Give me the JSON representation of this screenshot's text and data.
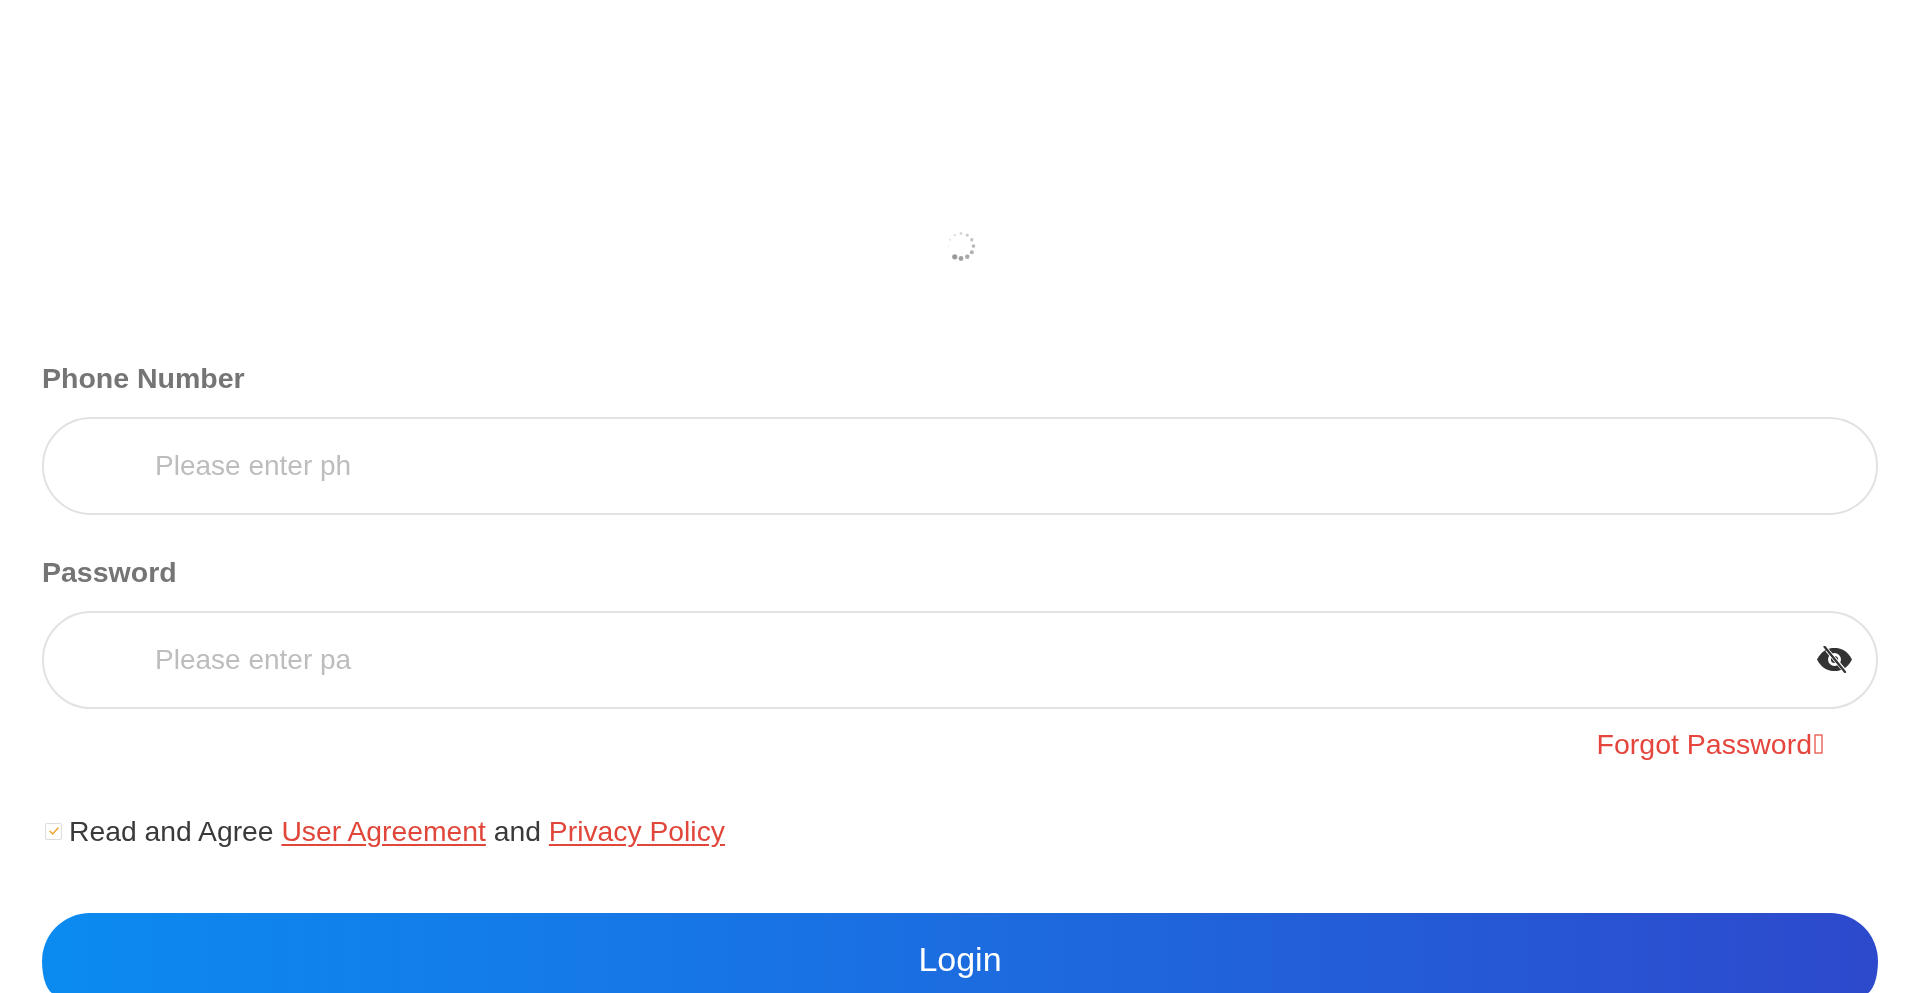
{
  "phone": {
    "label": "Phone Number",
    "placeholder": "Please enter ph"
  },
  "password": {
    "label": "Password",
    "placeholder": "Please enter pa",
    "visible": false
  },
  "forgot_password": "Forgot Password",
  "agreement": {
    "checked": true,
    "parts": [
      {
        "kind": "text",
        "text": "Read and Agree"
      },
      {
        "kind": "link",
        "text": "User Agreement"
      },
      {
        "kind": "text",
        "text": "and"
      },
      {
        "kind": "link",
        "text": "Privacy Policy"
      }
    ]
  },
  "login_button": "Login"
}
